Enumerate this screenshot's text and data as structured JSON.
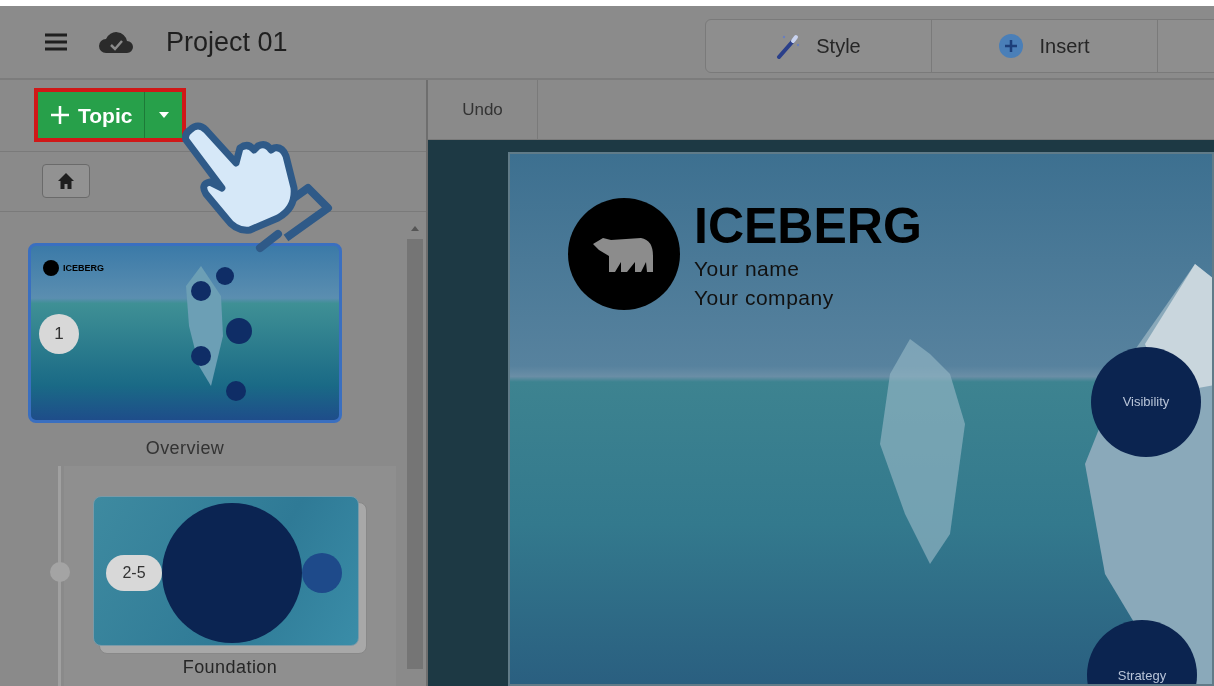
{
  "header": {
    "title": "Project 01",
    "tabs": [
      {
        "label": "Style",
        "kind": "style",
        "selected": false
      },
      {
        "label": "Insert",
        "kind": "insert",
        "selected": false
      }
    ]
  },
  "sidebar": {
    "add_button": {
      "label": "Topic",
      "highlighted": true
    },
    "topics": [
      {
        "number": "1",
        "label": "Overview",
        "selected": true,
        "kind": "overview",
        "thumb_title": "ICEBERG",
        "children": [
          {
            "number": "2-5",
            "label": "Foundation",
            "selected": false,
            "kind": "group"
          }
        ]
      }
    ]
  },
  "toolbar": {
    "undo": "Undo"
  },
  "slide": {
    "title": "ICEBERG",
    "lines": [
      "Your name",
      "Your company"
    ],
    "bubbles": [
      "Visibility",
      "Strategy"
    ]
  }
}
